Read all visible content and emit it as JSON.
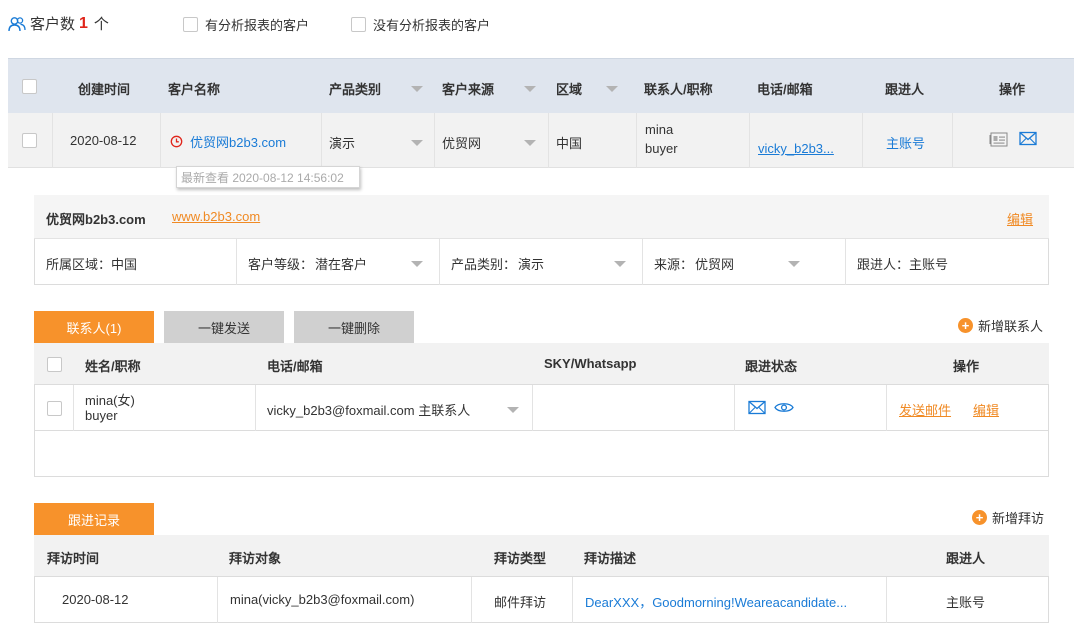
{
  "top": {
    "count_label": "客户数",
    "count_value": "1",
    "count_unit": "个",
    "filter_has_report": "有分析报表的客户",
    "filter_no_report": "没有分析报表的客户"
  },
  "main_table": {
    "headers": {
      "created": "创建时间",
      "name": "客户名称",
      "category": "产品类别",
      "source": "客户来源",
      "region": "区域",
      "contact": "联系人/职称",
      "phone": "电话/邮箱",
      "follower": "跟进人",
      "action": "操作"
    },
    "row": {
      "created": "2020-08-12",
      "name": "优贸网b2b3.com",
      "category": "演示",
      "source": "优贸网",
      "region": "中国",
      "contact_name": "mina",
      "contact_title": "buyer",
      "email": "vicky_b2b3...",
      "follower": "主账号"
    },
    "tooltip": "最新查看  2020-08-12 14:56:02"
  },
  "detail": {
    "company": "优贸网b2b3.com",
    "website": "www.b2b3.com",
    "edit": "编辑",
    "region": "所属区域：中国",
    "level_label": "客户等级：",
    "level_value": "潜在客户",
    "category_label": "产品类别：",
    "category_value": "演示",
    "source_label": "来源：",
    "source_value": "优贸网",
    "follower": "跟进人：主账号"
  },
  "contacts": {
    "tab_contacts": "联系人(1)",
    "tab_send": "一键发送",
    "tab_delete": "一键删除",
    "add_contact": "新增联系人",
    "headers": {
      "name": "姓名/职称",
      "phone": "电话/邮箱",
      "sky": "SKY/Whatsapp",
      "status": "跟进状态",
      "action": "操作"
    },
    "row": {
      "name": "mina(女)",
      "title": "buyer",
      "email": "vicky_b2b3@foxmail.com 主联系人",
      "send_mail": "发送邮件",
      "edit": "编辑"
    }
  },
  "visits": {
    "tab": "跟进记录",
    "add_visit": "新增拜访",
    "headers": {
      "time": "拜访时间",
      "target": "拜访对象",
      "type": "拜访类型",
      "desc": "拜访描述",
      "follower": "跟进人"
    },
    "row": {
      "time": "2020-08-12",
      "target": "mina(vicky_b2b3@foxmail.com)",
      "type": "邮件拜访",
      "desc": "DearXXX，Goodmorning!Weareacandidate...",
      "follower": "主账号"
    }
  },
  "colors": {
    "accent_orange": "#f7922b",
    "link_blue": "#1a7bd6",
    "header_bg": "#dfe5ee",
    "count_red": "#e0251b"
  }
}
